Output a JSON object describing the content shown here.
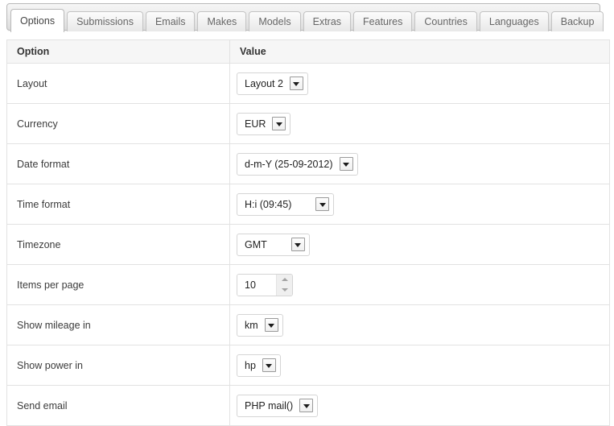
{
  "tabs": [
    {
      "label": "Options",
      "active": true
    },
    {
      "label": "Submissions",
      "active": false
    },
    {
      "label": "Emails",
      "active": false
    },
    {
      "label": "Makes",
      "active": false
    },
    {
      "label": "Models",
      "active": false
    },
    {
      "label": "Extras",
      "active": false
    },
    {
      "label": "Features",
      "active": false
    },
    {
      "label": "Countries",
      "active": false
    },
    {
      "label": "Languages",
      "active": false
    },
    {
      "label": "Backup",
      "active": false
    }
  ],
  "table": {
    "headers": {
      "option": "Option",
      "value": "Value"
    },
    "rows": [
      {
        "option": "Layout",
        "control": "select",
        "value": "Layout 2",
        "wide": false
      },
      {
        "option": "Currency",
        "control": "select",
        "value": "EUR",
        "wide": false
      },
      {
        "option": "Date format",
        "control": "select",
        "value": "d-m-Y (25-09-2012)",
        "wide": false
      },
      {
        "option": "Time format",
        "control": "select",
        "value": "H:i (09:45)",
        "wide": true
      },
      {
        "option": "Timezone",
        "control": "select",
        "value": "GMT",
        "wide": true
      },
      {
        "option": "Items per page",
        "control": "spinner",
        "value": "10",
        "wide": false
      },
      {
        "option": "Show mileage in",
        "control": "select",
        "value": "km",
        "wide": false
      },
      {
        "option": "Show power in",
        "control": "select",
        "value": "hp",
        "wide": false
      },
      {
        "option": "Send email",
        "control": "select",
        "value": "PHP mail()",
        "wide": false
      }
    ]
  },
  "colors": {
    "header_bg": "#f6f6f6",
    "border": "#e2e2e2",
    "tab_active_bg": "#ffffff",
    "tabbar_bg": "#e9e9e9",
    "text": "#3b3b3b"
  }
}
